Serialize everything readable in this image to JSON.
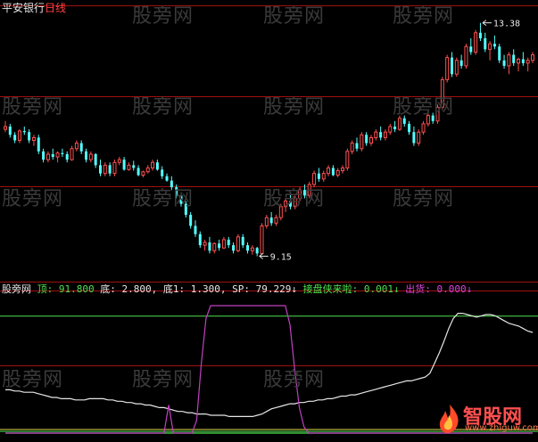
{
  "header": {
    "stock_name": "平安银行",
    "period": "日线"
  },
  "watermark_text": "股旁网",
  "indicator_bar": {
    "name": "股旁网",
    "items": [
      {
        "label": "顶:",
        "value": "91.800",
        "color": "green"
      },
      {
        "label": "底:",
        "value": "2.800,",
        "color": "white"
      },
      {
        "label": "底1:",
        "value": "1.300,",
        "color": "white"
      },
      {
        "label": "SP:",
        "value": "79.229↓",
        "color": "white"
      },
      {
        "label": "接盘侠来啦:",
        "value": "0.001↓",
        "color": "green"
      },
      {
        "label": "出货:",
        "value": "0.000↓",
        "color": "magenta"
      }
    ]
  },
  "logo": {
    "text": "智股网",
    "url": "www.zhiguw.com"
  },
  "colors": {
    "up": "#ff5050",
    "down": "#54ffff",
    "sp": "#e6e6e6",
    "signal": "#c040c0",
    "top": "#50e050",
    "bottom": "#e0e050",
    "grid": "#a01010"
  },
  "chart_data": [
    {
      "type": "candlestick",
      "ylim": [
        8.9,
        13.6
      ],
      "annotations": [
        {
          "text": "13.38",
          "value": 13.38,
          "candle_index": 100
        },
        {
          "text": "9.15",
          "value": 9.15,
          "candle_index": 53
        }
      ],
      "candles": [
        [
          11.45,
          11.6,
          11.4,
          11.5
        ],
        [
          11.5,
          11.55,
          11.3,
          11.35
        ],
        [
          11.35,
          11.4,
          11.2,
          11.25
        ],
        [
          11.25,
          11.45,
          11.2,
          11.42
        ],
        [
          11.42,
          11.5,
          11.35,
          11.4
        ],
        [
          11.4,
          11.45,
          11.2,
          11.25
        ],
        [
          11.25,
          11.35,
          11.15,
          11.3
        ],
        [
          11.3,
          11.35,
          11.0,
          11.05
        ],
        [
          11.05,
          11.1,
          10.85,
          10.9
        ],
        [
          10.9,
          11.05,
          10.85,
          11.0
        ],
        [
          11.0,
          11.1,
          10.9,
          10.95
        ],
        [
          10.95,
          11.05,
          10.85,
          11.02
        ],
        [
          11.02,
          11.1,
          10.95,
          11.0
        ],
        [
          11.0,
          11.05,
          10.85,
          10.9
        ],
        [
          10.9,
          11.15,
          10.88,
          11.1
        ],
        [
          11.1,
          11.25,
          11.05,
          11.2
        ],
        [
          11.2,
          11.25,
          11.0,
          11.05
        ],
        [
          11.05,
          11.1,
          10.85,
          10.9
        ],
        [
          10.9,
          11.05,
          10.85,
          11.0
        ],
        [
          11.0,
          11.02,
          10.75,
          10.8
        ],
        [
          10.8,
          10.9,
          10.6,
          10.65
        ],
        [
          10.65,
          10.85,
          10.6,
          10.8
        ],
        [
          10.8,
          10.85,
          10.6,
          10.65
        ],
        [
          10.65,
          10.9,
          10.6,
          10.85
        ],
        [
          10.85,
          10.95,
          10.8,
          10.9
        ],
        [
          10.9,
          10.95,
          10.7,
          10.72
        ],
        [
          10.72,
          10.85,
          10.7,
          10.8
        ],
        [
          10.8,
          10.88,
          10.7,
          10.75
        ],
        [
          10.75,
          10.8,
          10.6,
          10.62
        ],
        [
          10.62,
          10.7,
          10.58,
          10.68
        ],
        [
          10.68,
          10.8,
          10.65,
          10.75
        ],
        [
          10.75,
          10.9,
          10.7,
          10.85
        ],
        [
          10.85,
          10.9,
          10.7,
          10.72
        ],
        [
          10.72,
          10.78,
          10.55,
          10.6
        ],
        [
          10.6,
          10.65,
          10.5,
          10.52
        ],
        [
          10.52,
          10.6,
          10.35,
          10.4
        ],
        [
          10.4,
          10.45,
          10.2,
          10.25
        ],
        [
          10.25,
          10.3,
          10.05,
          10.1
        ],
        [
          10.1,
          10.15,
          9.85,
          9.9
        ],
        [
          9.9,
          9.95,
          9.65,
          9.7
        ],
        [
          9.7,
          9.8,
          9.5,
          9.55
        ],
        [
          9.55,
          9.6,
          9.3,
          9.35
        ],
        [
          9.35,
          9.45,
          9.25,
          9.4
        ],
        [
          9.4,
          9.5,
          9.2,
          9.25
        ],
        [
          9.25,
          9.4,
          9.2,
          9.38
        ],
        [
          9.38,
          9.45,
          9.25,
          9.3
        ],
        [
          9.3,
          9.5,
          9.28,
          9.45
        ],
        [
          9.45,
          9.5,
          9.3,
          9.35
        ],
        [
          9.35,
          9.4,
          9.2,
          9.25
        ],
        [
          9.25,
          9.55,
          9.22,
          9.5
        ],
        [
          9.5,
          9.55,
          9.3,
          9.35
        ],
        [
          9.35,
          9.4,
          9.2,
          9.25
        ],
        [
          9.25,
          9.35,
          9.18,
          9.3
        ],
        [
          9.3,
          9.32,
          9.15,
          9.2
        ],
        [
          9.2,
          9.75,
          9.18,
          9.7
        ],
        [
          9.7,
          9.9,
          9.65,
          9.85
        ],
        [
          9.85,
          9.95,
          9.7,
          9.75
        ],
        [
          9.75,
          9.9,
          9.7,
          9.85
        ],
        [
          9.85,
          10.1,
          9.8,
          10.05
        ],
        [
          10.05,
          10.2,
          9.95,
          10.15
        ],
        [
          10.15,
          10.3,
          10.0,
          10.05
        ],
        [
          10.05,
          10.25,
          10.0,
          10.2
        ],
        [
          10.2,
          10.4,
          10.15,
          10.35
        ],
        [
          10.35,
          10.45,
          10.2,
          10.25
        ],
        [
          10.25,
          10.5,
          10.2,
          10.45
        ],
        [
          10.45,
          10.7,
          10.4,
          10.65
        ],
        [
          10.65,
          10.75,
          10.5,
          10.55
        ],
        [
          10.55,
          10.7,
          10.5,
          10.65
        ],
        [
          10.65,
          10.8,
          10.6,
          10.75
        ],
        [
          10.75,
          10.8,
          10.6,
          10.62
        ],
        [
          10.62,
          10.75,
          10.58,
          10.7
        ],
        [
          10.7,
          10.8,
          10.65,
          10.75
        ],
        [
          10.75,
          11.1,
          10.7,
          11.05
        ],
        [
          11.05,
          11.25,
          11.0,
          11.2
        ],
        [
          11.2,
          11.3,
          11.05,
          11.1
        ],
        [
          11.1,
          11.4,
          11.05,
          11.35
        ],
        [
          11.35,
          11.4,
          11.15,
          11.2
        ],
        [
          11.2,
          11.35,
          11.15,
          11.3
        ],
        [
          11.3,
          11.45,
          11.25,
          11.4
        ],
        [
          11.4,
          11.5,
          11.25,
          11.3
        ],
        [
          11.3,
          11.45,
          11.25,
          11.4
        ],
        [
          11.4,
          11.55,
          11.35,
          11.5
        ],
        [
          11.5,
          11.6,
          11.4,
          11.45
        ],
        [
          11.45,
          11.7,
          11.42,
          11.65
        ],
        [
          11.65,
          11.7,
          11.5,
          11.55
        ],
        [
          11.55,
          11.6,
          11.35,
          11.4
        ],
        [
          11.4,
          11.5,
          11.15,
          11.2
        ],
        [
          11.2,
          11.45,
          11.15,
          11.4
        ],
        [
          11.4,
          11.6,
          11.35,
          11.55
        ],
        [
          11.55,
          11.75,
          11.5,
          11.7
        ],
        [
          11.7,
          11.75,
          11.55,
          11.6
        ],
        [
          11.6,
          11.9,
          11.55,
          11.85
        ],
        [
          11.85,
          12.4,
          11.8,
          12.35
        ],
        [
          12.35,
          12.8,
          12.3,
          12.75
        ],
        [
          12.75,
          12.85,
          12.4,
          12.45
        ],
        [
          12.45,
          12.75,
          12.4,
          12.7
        ],
        [
          12.7,
          12.8,
          12.55,
          12.6
        ],
        [
          12.6,
          13.0,
          12.55,
          12.95
        ],
        [
          12.95,
          13.1,
          12.8,
          12.85
        ],
        [
          12.85,
          13.25,
          12.8,
          13.2
        ],
        [
          13.2,
          13.38,
          13.05,
          13.1
        ],
        [
          13.1,
          13.2,
          12.85,
          12.9
        ],
        [
          12.9,
          13.05,
          12.7,
          13.0
        ],
        [
          13.0,
          13.15,
          12.9,
          12.95
        ],
        [
          12.95,
          13.0,
          12.65,
          12.7
        ],
        [
          12.7,
          12.8,
          12.55,
          12.6
        ],
        [
          12.6,
          12.85,
          12.45,
          12.8
        ],
        [
          12.8,
          12.9,
          12.6,
          12.65
        ],
        [
          12.65,
          12.75,
          12.5,
          12.72
        ],
        [
          12.72,
          12.85,
          12.6,
          12.65
        ],
        [
          12.65,
          12.75,
          12.5,
          12.7
        ],
        [
          12.7,
          12.85,
          12.65,
          12.8
        ]
      ]
    },
    {
      "type": "line",
      "ylim": [
        0,
        100
      ],
      "reference_lines": [
        {
          "name": "顶",
          "value": 91.8
        },
        {
          "name": "底",
          "value": 2.8
        },
        {
          "name": "底1",
          "value": 1.3
        }
      ],
      "series": [
        {
          "name": "SP",
          "values": [
            34,
            34,
            33,
            33,
            32,
            32,
            32,
            31,
            30,
            29,
            28,
            28,
            27,
            27,
            27,
            26,
            26,
            26,
            27,
            27,
            27,
            27,
            26,
            26,
            25,
            25,
            24,
            24,
            23,
            23,
            22,
            22,
            21,
            20,
            20,
            19,
            18,
            17,
            17,
            16,
            16,
            15,
            15,
            15,
            14,
            14,
            14,
            14,
            13,
            13,
            13,
            13,
            13,
            13,
            14,
            15,
            17,
            19,
            20,
            21,
            22,
            23,
            23,
            24,
            24,
            25,
            25,
            26,
            26,
            27,
            27,
            28,
            29,
            29,
            30,
            30,
            31,
            32,
            33,
            34,
            35,
            36,
            37,
            38,
            39,
            40,
            41,
            41,
            42,
            43,
            44,
            47,
            55,
            63,
            72,
            82,
            90,
            94,
            94,
            93,
            92,
            91,
            92,
            93,
            93,
            92,
            90,
            88,
            86,
            85,
            84,
            82,
            80,
            79
          ]
        },
        {
          "name": "接盘侠来啦",
          "values": [
            0,
            0,
            0,
            0,
            0,
            0,
            0,
            0,
            0,
            0,
            0,
            0,
            0,
            0,
            0,
            0,
            0,
            0,
            0,
            0,
            0,
            0,
            0,
            0,
            0,
            0,
            0,
            0,
            0,
            0,
            0,
            0,
            0,
            0,
            0,
            0,
            0,
            0,
            0,
            0,
            0,
            0,
            0,
            0,
            0,
            0,
            0,
            0,
            0,
            0,
            0,
            0,
            0,
            0,
            0,
            0,
            0,
            0,
            0,
            0,
            0,
            0,
            0,
            0,
            0,
            0,
            0,
            0,
            0,
            0,
            0,
            0,
            0,
            0,
            0,
            0,
            0,
            0,
            0,
            0,
            0,
            0,
            0,
            0,
            0,
            0,
            0,
            0,
            0,
            0,
            0,
            0,
            0,
            0,
            0,
            0,
            0,
            0,
            0,
            0,
            0,
            0,
            0,
            0,
            0,
            0,
            0,
            0,
            0,
            0,
            0,
            0,
            0,
            0
          ]
        },
        {
          "name": "出货",
          "values": [
            0,
            0,
            0,
            0,
            0,
            0,
            0,
            0,
            0,
            0,
            0,
            0,
            0,
            0,
            0,
            0,
            0,
            0,
            0,
            0,
            0,
            0,
            0,
            0,
            0,
            0,
            0,
            0,
            0,
            0,
            0,
            0,
            0,
            0,
            0,
            22,
            0,
            0,
            0,
            0,
            0,
            10,
            55,
            90,
            100,
            100,
            100,
            100,
            100,
            100,
            100,
            100,
            100,
            100,
            100,
            100,
            100,
            100,
            100,
            100,
            100,
            85,
            50,
            20,
            5,
            0,
            0,
            0,
            0,
            0,
            0,
            0,
            0,
            0,
            0,
            0,
            0,
            0,
            0,
            0,
            0,
            0,
            0,
            0,
            0,
            0,
            0,
            0,
            0,
            0,
            0,
            0,
            0,
            0,
            0,
            0,
            0,
            0,
            0,
            0,
            0,
            0,
            0,
            0,
            0,
            0,
            0,
            0,
            0,
            0,
            0,
            0,
            0,
            0
          ]
        }
      ]
    }
  ]
}
